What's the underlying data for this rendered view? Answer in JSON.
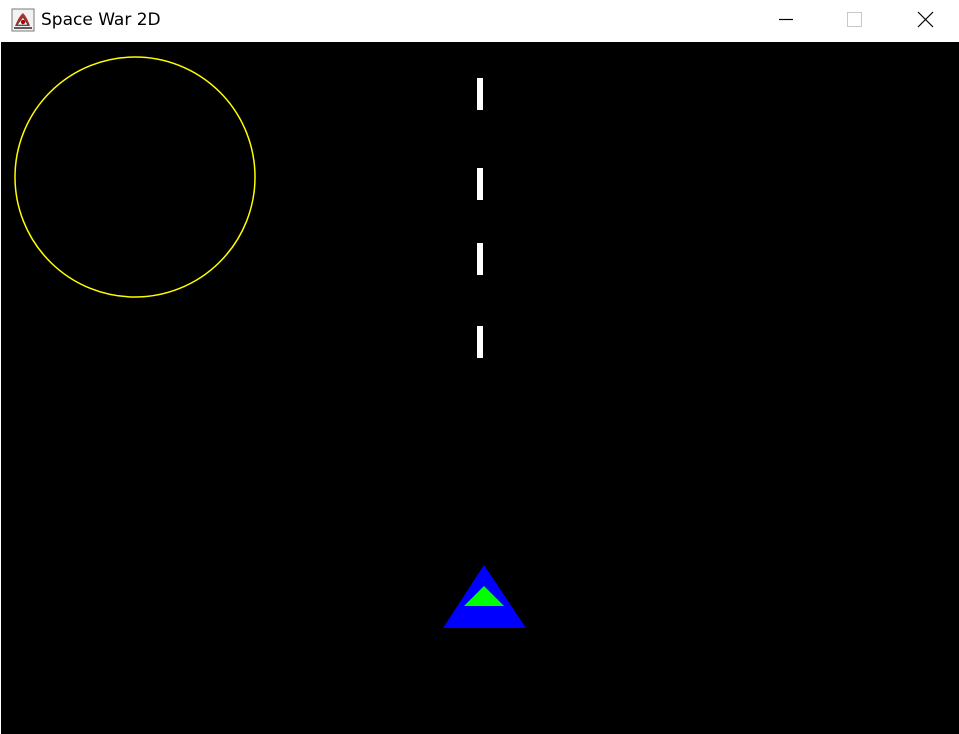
{
  "window": {
    "title": "Space War 2D",
    "app_icon": "java-app-icon",
    "controls": {
      "minimize": "minimize-icon",
      "maximize": "maximize-icon",
      "close": "close-icon"
    }
  },
  "game": {
    "background_color": "#000000",
    "planet": {
      "icon": "planet-outline",
      "color": "#ffff00"
    },
    "bullets": {
      "icon": "laser-bullet",
      "color": "#ffffff",
      "count": 4
    },
    "player_ship": {
      "icon": "triangle-ship",
      "hull_color": "#0000ff",
      "cockpit_color": "#00ff00"
    }
  }
}
